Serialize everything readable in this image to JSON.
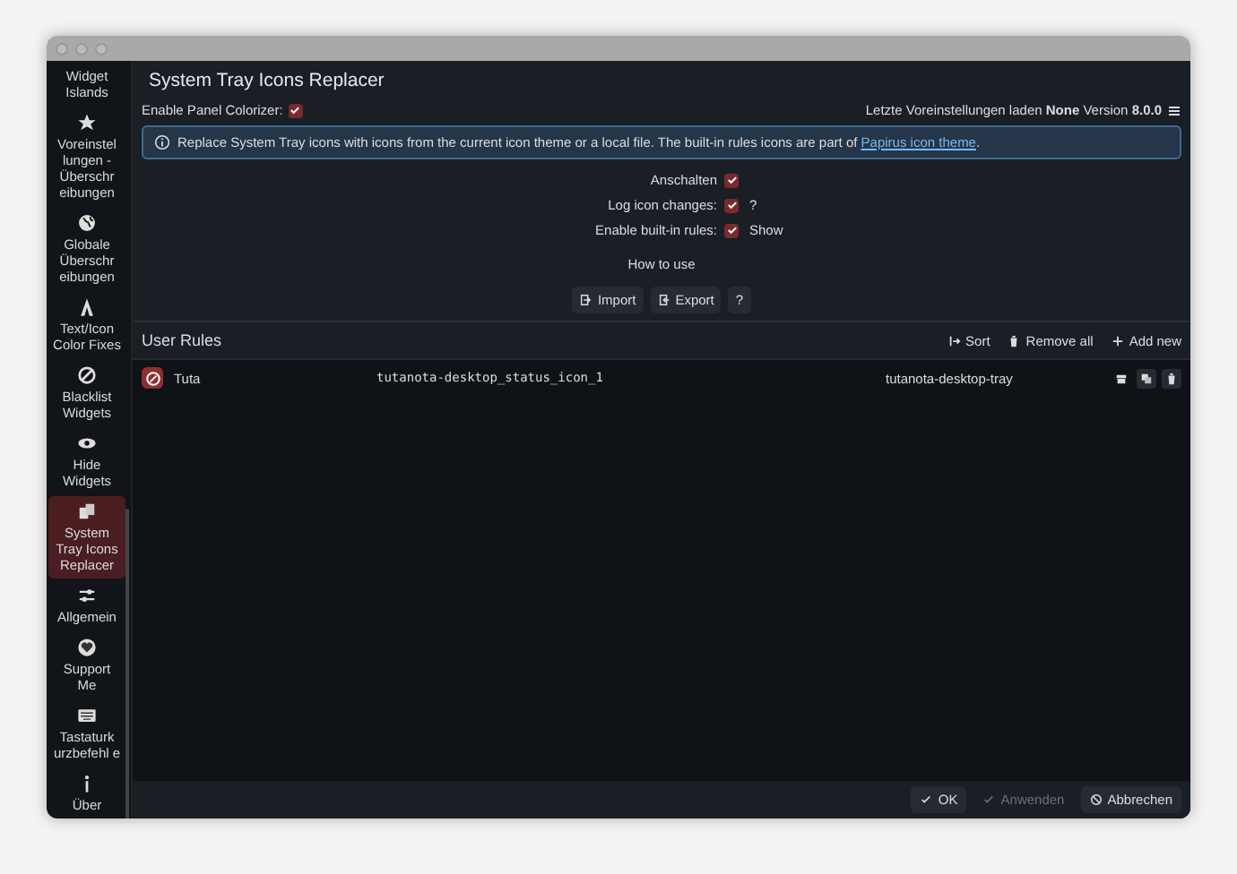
{
  "sidebar": {
    "items": [
      {
        "label": "Widget Islands",
        "selected": false
      },
      {
        "label": "Voreinstel lungen - Überschr eibungen",
        "selected": false
      },
      {
        "label": "Globale Überschr eibungen",
        "selected": false
      },
      {
        "label": "Text/Icon Color Fixes",
        "selected": false
      },
      {
        "label": "Blacklist Widgets",
        "selected": false
      },
      {
        "label": "Hide Widgets",
        "selected": false
      },
      {
        "label": "System Tray Icons Replacer",
        "selected": true
      },
      {
        "label": "Allgemein",
        "selected": false
      },
      {
        "label": "Support Me",
        "selected": false
      },
      {
        "label": "Tastaturk urzbefehl e",
        "selected": false
      },
      {
        "label": "Über",
        "selected": false
      }
    ]
  },
  "header": {
    "title": "System Tray Icons Replacer",
    "panel_colorizer": {
      "label": "Enable Panel Colorizer:",
      "checked": true
    },
    "presets": "Letzte Voreinstellungen laden **None** Version **8.0.0**"
  },
  "info": {
    "text": "Replace System Tray icons with icons from the current icon theme or a local file. The built-in rules icons are part of",
    "link": "Papirus icon theme",
    "end": "."
  },
  "options": [
    {
      "label": "Anschalten",
      "checked": true
    },
    {
      "label": "Log icon changes:",
      "checked": true,
      "extra": "?"
    },
    {
      "label": "Enable built-in rules:",
      "checked": true,
      "extra": "Show"
    }
  ],
  "how_to_use": "How to use",
  "actions": [
    "Import",
    "Export",
    "?"
  ],
  "rules": {
    "title": "User Rules",
    "tools": [
      "Sort",
      "Remove all",
      "Add new"
    ],
    "rows": [
      {
        "name": "Tuta",
        "icon_id": "tutanota-desktop_status_icon_1",
        "process": "tutanota-desktop-tray"
      }
    ]
  },
  "footer": {
    "buttons": [
      {
        "label": "OK",
        "disabled": false
      },
      {
        "label": "Anwenden",
        "disabled": true
      },
      {
        "label": "Abbrechen",
        "disabled": false
      }
    ]
  }
}
